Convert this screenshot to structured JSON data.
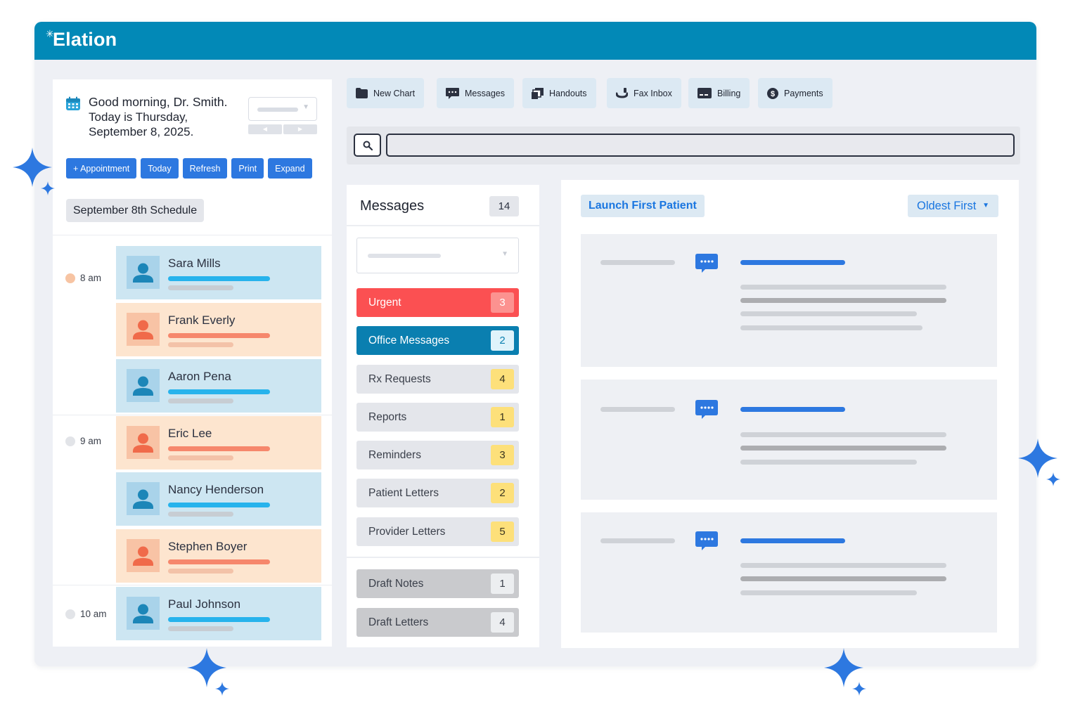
{
  "app": {
    "logo": "Elation"
  },
  "colors": {
    "brand": "#0289b7",
    "accent": "#2d78e0",
    "urgent": "#fb5052",
    "office": "#0a7fb0",
    "badge_yellow": "#fde07a"
  },
  "schedule": {
    "greeting": "Good morning, Dr. Smith.",
    "today_line": "Today is Thursday,",
    "date_line": "September 8, 2025.",
    "buttons": [
      "+ Appointment",
      "Today",
      "Refresh",
      "Print",
      "Expand"
    ],
    "title": "September 8th Schedule",
    "slots": [
      {
        "time": "8 am",
        "appointments": [
          "Sara Mills",
          "Frank Everly",
          "Aaron Pena"
        ]
      },
      {
        "time": "9 am",
        "appointments": [
          "Eric Lee",
          "Nancy Henderson",
          "Stephen Boyer"
        ]
      },
      {
        "time": "10 am",
        "appointments": [
          "Paul Johnson"
        ]
      }
    ]
  },
  "toolbar": [
    {
      "label": "New Chart",
      "icon": "folder-icon"
    },
    {
      "label": "Messages",
      "icon": "message-icon"
    },
    {
      "label": "Handouts",
      "icon": "handouts-icon"
    },
    {
      "label": "Fax Inbox",
      "icon": "fax-icon"
    },
    {
      "label": "Billing",
      "icon": "billing-icon"
    },
    {
      "label": "Payments",
      "icon": "dollar-icon"
    }
  ],
  "search": {
    "value": "",
    "icon": "search-icon"
  },
  "messages": {
    "title": "Messages",
    "count": "14",
    "categories": [
      {
        "label": "Urgent",
        "count": "3"
      },
      {
        "label": "Office Messages",
        "count": "2"
      },
      {
        "label": "Rx Requests",
        "count": "4"
      },
      {
        "label": "Reports",
        "count": "1"
      },
      {
        "label": "Reminders",
        "count": "3"
      },
      {
        "label": "Patient Letters",
        "count": "2"
      },
      {
        "label": "Provider Letters",
        "count": "5"
      }
    ],
    "drafts": [
      {
        "label": "Draft Notes",
        "count": "1"
      },
      {
        "label": "Draft Letters",
        "count": "4"
      }
    ]
  },
  "inbox": {
    "launch_label": "Launch First Patient",
    "sort_label": "Oldest First",
    "sort_caret": "▼"
  }
}
